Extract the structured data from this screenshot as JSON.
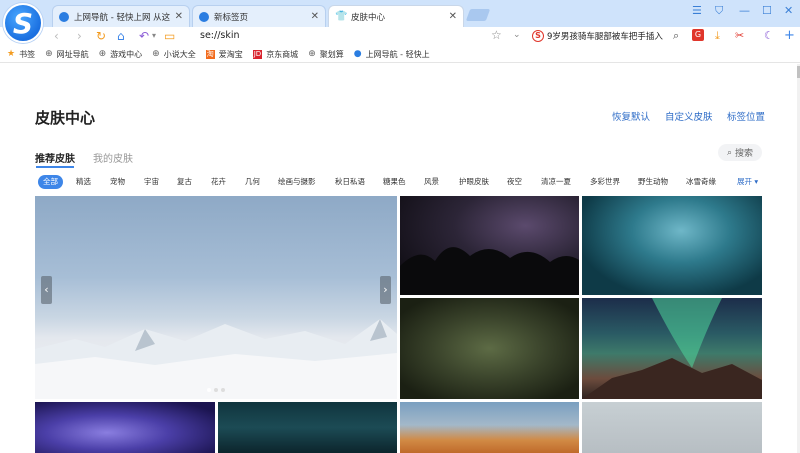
{
  "browser": {
    "tabs": [
      {
        "title": "上网导航 - 轻快上网 从这里开始"
      },
      {
        "title": "新标签页"
      },
      {
        "title": "皮肤中心"
      }
    ],
    "window_controls": [
      "☰",
      "⛉",
      "—",
      "☐",
      "✕"
    ],
    "address": "se://skin",
    "search_text": "9岁男孩骑车腿部被车把手插入",
    "accent": "#3e86e8"
  },
  "bookmarks": [
    {
      "label": "书签",
      "icon": "star-icon"
    },
    {
      "label": "网址导航",
      "icon": "globe-icon"
    },
    {
      "label": "游戏中心",
      "icon": "globe-icon"
    },
    {
      "label": "小说大全",
      "icon": "globe-icon"
    },
    {
      "label": "爱淘宝",
      "icon": "taobao-icon"
    },
    {
      "label": "京东商城",
      "icon": "jd-icon"
    },
    {
      "label": "聚划算",
      "icon": "globe-icon"
    },
    {
      "label": "上网导航 - 轻快上",
      "icon": "browser-logo-icon"
    }
  ],
  "page": {
    "title": "皮肤中心",
    "links": {
      "restore": "恢复默认",
      "custom": "自定义皮肤",
      "tab_pos": "标签位置"
    },
    "subtabs": {
      "recommended": "推荐皮肤",
      "mine": "我的皮肤"
    },
    "search_label": "搜索",
    "categories": [
      "全部",
      "精选",
      "宠物",
      "宇宙",
      "复古",
      "花卉",
      "几何",
      "绘画与摄影",
      "秋日私语",
      "糖果色",
      "风景",
      "护眼皮肤",
      "夜空",
      "清凉一夏",
      "多彩世界",
      "野生动物",
      "冰雪奇缘"
    ],
    "more_label": "展开 ▾"
  }
}
